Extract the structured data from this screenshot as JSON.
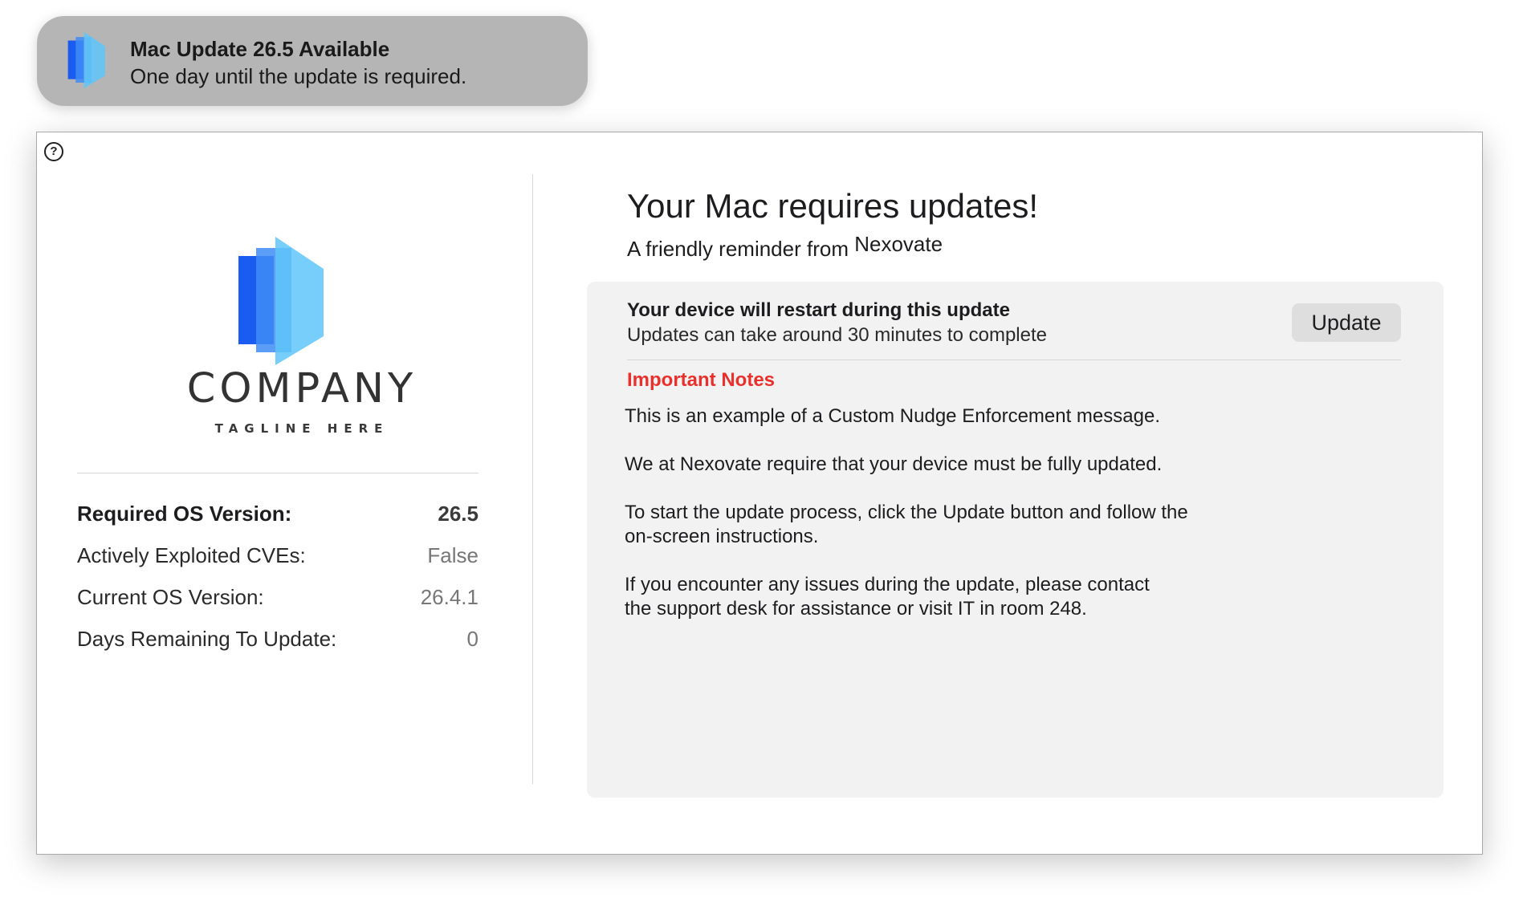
{
  "notification": {
    "title": "Mac Update 26.5 Available",
    "body": "One day until the update is required.",
    "icon": "company-logo-icon"
  },
  "window": {
    "help_icon": "?",
    "logo": {
      "name": "COMPANY",
      "tagline": "TAGLINE HERE"
    },
    "info": {
      "required_os_label": "Required OS Version:",
      "required_os_value": "26.5",
      "cves_label": "Actively Exploited CVEs:",
      "cves_value": "False",
      "current_os_label": "Current OS Version:",
      "current_os_value": "26.4.1",
      "days_label": "Days Remaining To Update:",
      "days_value": "0"
    },
    "title": "Your Mac requires updates!",
    "subtitle_prefix": "A friendly reminder from",
    "organization": "Nexovate",
    "panel": {
      "restart_title": "Your device will restart during this update",
      "restart_subtitle": "Updates can take around 30 minutes to complete",
      "update_button": "Update",
      "notes_title": "Important Notes",
      "notes_body": "This is an example of a Custom Nudge Enforcement message.\n\nWe at Nexovate require that your device must be fully updated.\n\nTo start the update process, click the Update button and follow the\non-screen instructions.\n\nIf you encounter any issues during the update, please contact\nthe support desk for assistance or visit IT in room 248."
    }
  },
  "colors": {
    "notes_accent": "#e8312d",
    "logo_dark_blue": "#1a5cf0",
    "logo_mid_blue": "#3f8cf7",
    "logo_light_blue": "#5fc6f9"
  }
}
